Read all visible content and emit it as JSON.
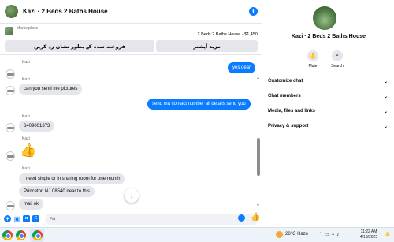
{
  "header": {
    "title": "Kazi · 2 Beds 2 Baths House"
  },
  "marketplace": {
    "label": "Marketplace",
    "listing": "2 Beds 2 Baths House - $1,450",
    "btn_sold": "فروخت شدہ کے بطور نشان زد کریں",
    "btn_more": "مزید آپشنز"
  },
  "messages": [
    {
      "sender": "Kazi",
      "text": ""
    },
    {
      "text": "yes dear",
      "direction": "out"
    },
    {
      "sender": "Kazi",
      "text": "can you send me pictures",
      "direction": "in"
    },
    {
      "text": "send ma contact number all details send you",
      "direction": "out"
    },
    {
      "sender": "Kazi",
      "text": "6409001373",
      "direction": "in"
    },
    {
      "sender": "Kazi",
      "text": "i need single or in sharing room for one month",
      "direction": "in"
    },
    {
      "text": "Princeton NJ 08540 near to this",
      "direction": "in"
    },
    {
      "text": "mail ok",
      "direction": "in"
    }
  ],
  "composer": {
    "placeholder": "Aa"
  },
  "side": {
    "title": "Kazi · 2 Beds 2 Baths House",
    "mute_label": "Mute",
    "search_label": "Search",
    "rows": [
      "Customize chat",
      "Chat members",
      "Media, files and links",
      "Privacy & support"
    ]
  },
  "taskbar": {
    "weather": "28°C  Haze",
    "time": "11:22 AM",
    "date": "4/13/2025"
  },
  "colors": {
    "accent": "#0a7cff",
    "bubble_in": "#e4e6eb"
  }
}
